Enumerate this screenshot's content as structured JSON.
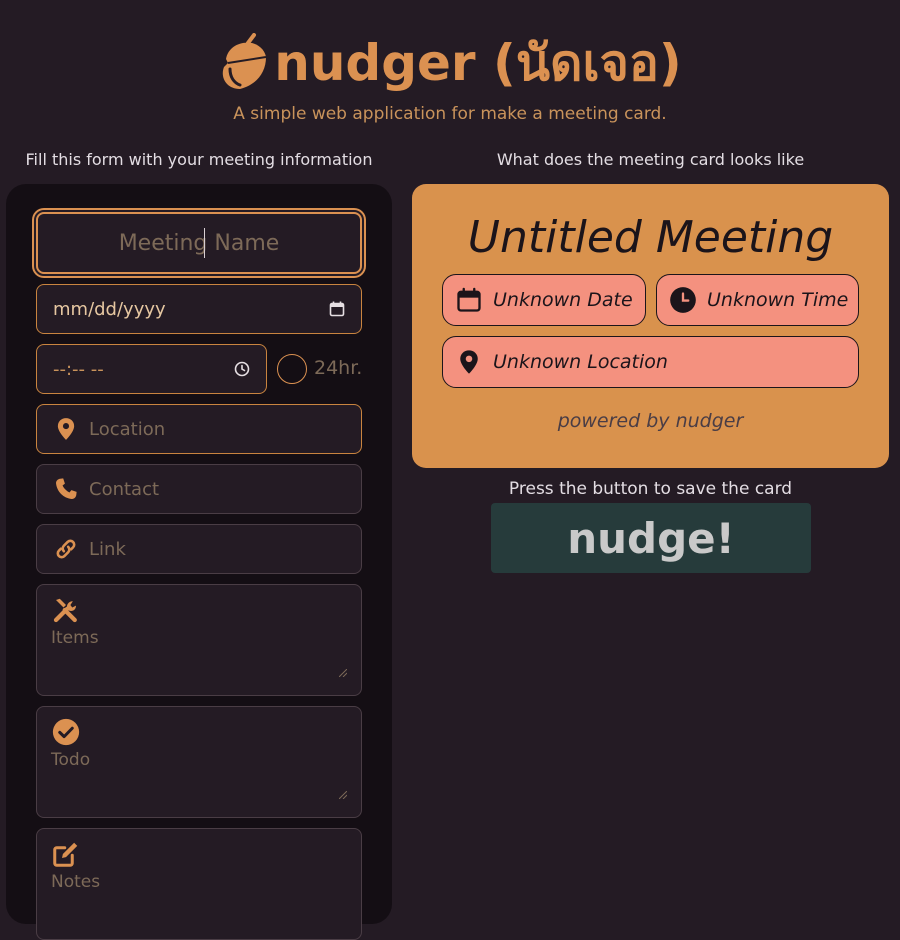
{
  "header": {
    "title": "nudger (นัดเจอ)",
    "subtitle": "A simple web application for make a meeting card."
  },
  "form": {
    "caption": "Fill this form with your meeting information",
    "meeting_name_placeholder": "Meeting Name",
    "date_placeholder": "mm/dd/yyyy",
    "time_placeholder": "--:-- --",
    "toggle_24_label": "24hr.",
    "location_placeholder": "Location",
    "contact_placeholder": "Contact",
    "link_placeholder": "Link",
    "items_placeholder": "Items",
    "todo_placeholder": "Todo",
    "notes_placeholder": "Notes"
  },
  "preview": {
    "caption": "What does the meeting card looks like",
    "title": "Untitled Meeting",
    "date": "Unknown Date",
    "time": "Unknown Time",
    "location": "Unknown Location",
    "footer": "powered by nudger"
  },
  "save": {
    "caption": "Press the button to save the card",
    "button_label": "nudge!"
  },
  "colors": {
    "background": "#241b24",
    "accent": "#db9151",
    "card": "#d9924d",
    "pill": "#f4917f",
    "button": "#263b3b"
  },
  "icons": [
    "acorn-icon",
    "calendar-icon",
    "clock-icon",
    "map-pin-icon",
    "phone-icon",
    "link-icon",
    "tools-icon",
    "check-circle-icon",
    "edit-icon"
  ]
}
